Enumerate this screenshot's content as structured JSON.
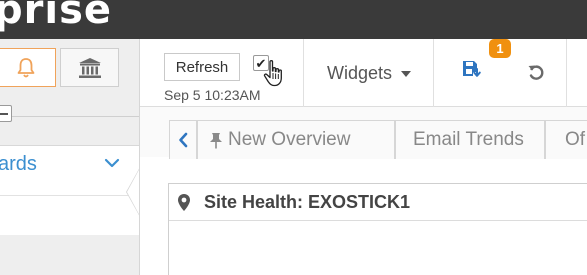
{
  "brand": {
    "name_fragment": "prise"
  },
  "sidebar": {
    "bell_icon": "bell-icon",
    "bank_icon": "bank-icon",
    "section_label": "ards",
    "accent_color": "#3b8fd0"
  },
  "toolbar": {
    "refresh_label": "Refresh",
    "auto_refresh_checked": "✔",
    "timestamp": "Sep 5 10:23AM",
    "widgets_label": "Widgets",
    "save_badge_count": "1",
    "badge_color": "#f0900f"
  },
  "tabs": [
    {
      "label": "New Overview",
      "pinned": true
    },
    {
      "label": "Email Trends"
    },
    {
      "label": "Of"
    }
  ],
  "panel": {
    "title": "Site Health: EXOSTICK1",
    "icon": "map-pin-icon"
  }
}
